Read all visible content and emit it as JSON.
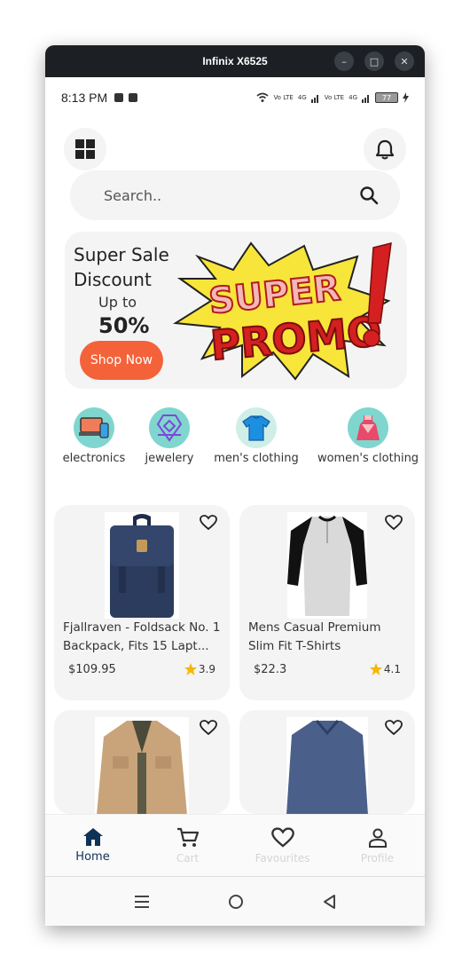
{
  "window": {
    "title": "Infinix X6525",
    "minimize": "–",
    "maximize": "□",
    "close": "✕"
  },
  "status": {
    "time": "8:13 PM",
    "battery": "77",
    "net1": "Vo LTE",
    "net2": "4G",
    "net3": "Vo LTE",
    "net4": "4G"
  },
  "search": {
    "placeholder": "Search.."
  },
  "promo": {
    "line1": "Super Sale Discount",
    "line2": "Up to",
    "line3": "50%",
    "button": "Shop Now",
    "banner_word1": "SUPER",
    "banner_word2": "PROMO"
  },
  "categories": [
    {
      "label": "electronics",
      "icon": "laptop-phone-icon",
      "color": "#7fd6cf"
    },
    {
      "label": "jewelery",
      "icon": "jewelry-icon",
      "color": "#7fd6cf"
    },
    {
      "label": "men's clothing",
      "icon": "tshirt-icon",
      "color": "#cfeee8"
    },
    {
      "label": "women's clothing",
      "icon": "dress-icon",
      "color": "#7fd6cf"
    }
  ],
  "products": [
    {
      "name": "Fjallraven - Foldsack No. 1 Backpack, Fits 15 Lapt...",
      "price": "$109.95",
      "rating": "3.9"
    },
    {
      "name": "Mens Casual Premium Slim Fit T-Shirts",
      "price": "$22.3",
      "rating": "4.1"
    },
    {
      "name": "",
      "price": "",
      "rating": ""
    },
    {
      "name": "",
      "price": "",
      "rating": ""
    }
  ],
  "nav": {
    "home": "Home",
    "cart": "Cart",
    "favourites": "Favourites",
    "profile": "Profile"
  },
  "colors": {
    "accent": "#f4623a",
    "nav_active": "#0f3257",
    "star": "#f5b800"
  }
}
